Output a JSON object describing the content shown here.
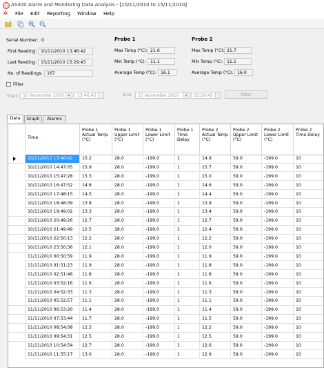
{
  "window": {
    "title": "AS300 Alarm and Monitoring Data Analysis - [10/11/2010 to 15/11/2010]"
  },
  "menu": [
    "File",
    "Edit",
    "Reporting",
    "Window",
    "Help"
  ],
  "toolbar": {
    "icons": [
      "open-folder-icon",
      "copy-icon",
      "zoom-in-icon",
      "zoom-out-icon"
    ]
  },
  "summary": {
    "serial_label": "Serial Number:",
    "serial_value": "0",
    "first_label": "First Reading:",
    "first_value": "10/11/2010 13:46:42",
    "last_label": "Last Reading:",
    "last_value": "15/11/2010 15:29:43",
    "count_label": "No. of Readings:",
    "count_value": "167"
  },
  "probe1": {
    "heading": "Probe 1",
    "max_label": "Max Temp (°C):",
    "max_value": "21.6",
    "min_label": "Min Temp (°C):",
    "min_value": "11.1",
    "avg_label": "Average Temp (°C):",
    "avg_value": "16.1"
  },
  "probe2": {
    "heading": "Probe 2",
    "max_label": "Max Temp (°C):",
    "max_value": "21.7",
    "min_label": "Min Temp (°C):",
    "min_value": "11.1",
    "avg_label": "Average Temp (°C):",
    "avg_value": "16.0"
  },
  "filter": {
    "label": "Filter",
    "start_label": "Start:",
    "start_date": "10 November 2010",
    "start_time": "13:46:42",
    "end_label": "End:",
    "end_date": "15 November 2010",
    "end_time": "15:29:43",
    "button": "Filter"
  },
  "tabs": [
    "Data",
    "Graph",
    "Alarms"
  ],
  "table": {
    "columns": [
      "Time",
      "Probe 1 Actual Temp (°C)",
      "Probe 1 Upper Limit (°C)",
      "Probe 1 Lower Limit (°C)",
      "Probe 1 Time Delay",
      "Probe 2 Actual Temp (°C)",
      "Probe 2 Upper Limit (°C)",
      "Probe 2 Lower Limit (°C)",
      "Probe 2 Time Delay"
    ],
    "rows": [
      [
        "10/11/2010 13:46:42",
        "15.2",
        "28.0",
        "-199.0",
        "1",
        "14.9",
        "59.0",
        "-199.0",
        "10"
      ],
      [
        "10/11/2010 14:47:05",
        "15.9",
        "28.0",
        "-199.0",
        "1",
        "15.7",
        "59.0",
        "-199.0",
        "10"
      ],
      [
        "10/11/2010 15:47:28",
        "15.3",
        "28.0",
        "-199.0",
        "1",
        "15.0",
        "59.0",
        "-199.0",
        "10"
      ],
      [
        "10/11/2010 16:47:52",
        "14.8",
        "28.0",
        "-199.0",
        "1",
        "14.6",
        "59.0",
        "-199.0",
        "10"
      ],
      [
        "10/11/2010 17:48:15",
        "14.5",
        "28.0",
        "-199.0",
        "1",
        "14.4",
        "59.0",
        "-199.0",
        "10"
      ],
      [
        "10/11/2010 18:48:39",
        "13.8",
        "28.0",
        "-199.0",
        "1",
        "13.9",
        "59.0",
        "-199.0",
        "10"
      ],
      [
        "10/11/2010 19:49:02",
        "13.3",
        "28.0",
        "-199.0",
        "1",
        "13.4",
        "59.0",
        "-199.0",
        "10"
      ],
      [
        "10/11/2010 20:49:26",
        "12.7",
        "28.0",
        "-199.0",
        "1",
        "12.7",
        "59.0",
        "-199.0",
        "10"
      ],
      [
        "10/11/2010 21:49:49",
        "12.5",
        "28.0",
        "-199.0",
        "1",
        "12.4",
        "59.0",
        "-199.0",
        "10"
      ],
      [
        "10/11/2010 22:50:13",
        "12.2",
        "28.0",
        "-199.0",
        "1",
        "12.2",
        "59.0",
        "-199.0",
        "10"
      ],
      [
        "10/11/2010 23:50:36",
        "12.1",
        "28.0",
        "-199.0",
        "1",
        "12.0",
        "59.0",
        "-199.0",
        "10"
      ],
      [
        "11/11/2010 00:50:59",
        "11.9",
        "28.0",
        "-199.0",
        "1",
        "11.9",
        "59.0",
        "-199.0",
        "10"
      ],
      [
        "11/11/2010 01:51:23",
        "11.9",
        "28.0",
        "-199.0",
        "1",
        "11.8",
        "59.0",
        "-199.0",
        "10"
      ],
      [
        "11/11/2010 02:51:46",
        "11.8",
        "28.0",
        "-199.0",
        "1",
        "11.8",
        "59.0",
        "-199.0",
        "10"
      ],
      [
        "11/11/2010 03:52:16",
        "11.6",
        "28.0",
        "-199.0",
        "1",
        "11.6",
        "59.0",
        "-199.0",
        "10"
      ],
      [
        "11/11/2010 04:52:33",
        "11.3",
        "28.0",
        "-199.0",
        "1",
        "11.3",
        "59.0",
        "-199.0",
        "10"
      ],
      [
        "11/11/2010 05:52:57",
        "11.1",
        "28.0",
        "-199.0",
        "1",
        "11.1",
        "59.0",
        "-199.0",
        "10"
      ],
      [
        "11/11/2010 06:53:20",
        "11.4",
        "28.0",
        "-199.0",
        "1",
        "11.4",
        "59.0",
        "-199.0",
        "10"
      ],
      [
        "11/11/2010 07:53:44",
        "11.7",
        "28.0",
        "-199.0",
        "1",
        "11.5",
        "59.0",
        "-199.0",
        "10"
      ],
      [
        "11/11/2010 08:54:08",
        "12.3",
        "28.0",
        "-199.0",
        "1",
        "12.2",
        "59.0",
        "-199.0",
        "10"
      ],
      [
        "11/11/2010 09:54:31",
        "12.5",
        "28.0",
        "-199.0",
        "1",
        "12.5",
        "59.0",
        "-199.0",
        "10"
      ],
      [
        "11/11/2010 10:54:54",
        "12.7",
        "28.0",
        "-199.0",
        "1",
        "12.6",
        "59.0",
        "-199.0",
        "10"
      ],
      [
        "11/11/2010 11:55:17",
        "13.0",
        "28.0",
        "-199.0",
        "1",
        "12.9",
        "59.0",
        "-199.0",
        "10"
      ]
    ]
  }
}
